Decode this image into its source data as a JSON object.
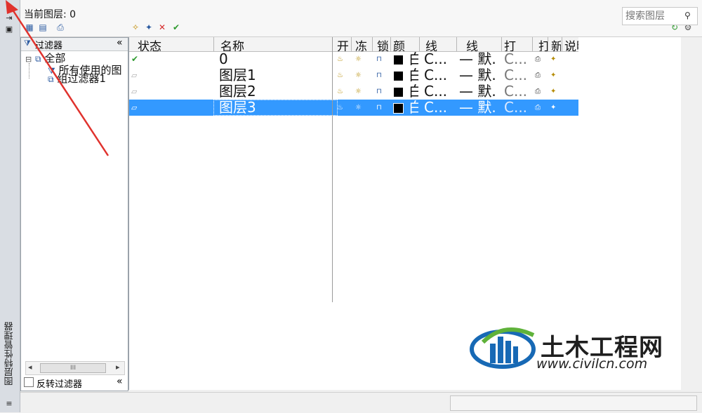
{
  "window": {
    "vertical_title": "图层特性管理器",
    "current_layer_label": "当前图层: 0"
  },
  "search": {
    "placeholder": "搜索图层"
  },
  "toolbar": {
    "icons": [
      "new-property-filter-icon",
      "new-group-filter-icon",
      "layer-states-manager-icon",
      "new-layer-icon",
      "new-layer-vp-frozen-icon",
      "delete-layer-icon",
      "set-current-icon",
      "refresh-icon",
      "settings-icon"
    ]
  },
  "filter_pane": {
    "header": "过滤器",
    "collapse": "«",
    "tree": [
      {
        "label": "全部",
        "level": 0
      },
      {
        "label": "所有使用的图",
        "level": 1
      },
      {
        "label": "组过滤器1",
        "level": 1
      }
    ],
    "invert_label": "反转过滤器",
    "scroll_left": "◂",
    "scroll_right": "▸",
    "thumb_grip": "III"
  },
  "grid": {
    "columns": [
      "状态",
      "名称",
      "开",
      "冻",
      "锁",
      "颜",
      "线",
      "线",
      "打",
      "打",
      "新",
      "说明"
    ],
    "rows": [
      {
        "status": "✔",
        "name": "0",
        "color": "白",
        "linetype": "C...",
        "lineweight": "— 默.",
        "plotstyle": "C...",
        "selected": false
      },
      {
        "status": "▱",
        "name": "图层1",
        "color": "白",
        "linetype": "C...",
        "lineweight": "— 默.",
        "plotstyle": "C...",
        "selected": false
      },
      {
        "status": "▱",
        "name": "图层2",
        "color": "白",
        "linetype": "C...",
        "lineweight": "— 默.",
        "plotstyle": "C...",
        "selected": false
      },
      {
        "status": "▱",
        "name": "图层3",
        "color": "白",
        "linetype": "C...",
        "lineweight": "— 默.",
        "plotstyle": "C...",
        "selected": true
      }
    ]
  },
  "watermark": {
    "brand": "土木工程网",
    "url": "www.civilcn.com"
  },
  "colors": {
    "selection": "#3399ff",
    "arrow": "#e0322d",
    "accent_blue": "#1769b5",
    "accent_green": "#5fb23a"
  }
}
